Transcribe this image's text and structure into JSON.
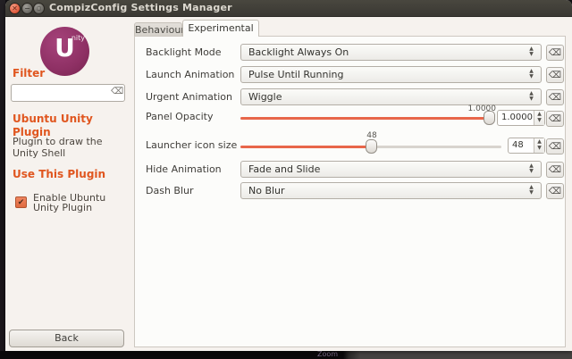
{
  "window": {
    "title": "CompizConfig Settings Manager"
  },
  "icons": {
    "close": "✕",
    "minimize": "−",
    "maximize": "◻",
    "clear": "⌫",
    "check": "✔",
    "spin_up": "▲",
    "spin_down": "▼"
  },
  "sidebar": {
    "logo_main": "U",
    "logo_sub": "nity",
    "filter_label": "Filter",
    "filter_value": "",
    "plugin_title": "Ubuntu Unity Plugin",
    "plugin_description": "Plugin to draw the Unity Shell",
    "use_plugin_heading": "Use This Plugin",
    "enable_label": "Enable Ubuntu Unity Plugin",
    "enable_checked": true,
    "back_label": "Back"
  },
  "tabs": {
    "behaviour": "Behaviour",
    "experimental": "Experimental",
    "active": "Experimental"
  },
  "settings": {
    "rows": [
      {
        "type": "dropdown",
        "label": "Backlight Mode",
        "value": "Backlight Always On"
      },
      {
        "type": "dropdown",
        "label": "Launch Animation",
        "value": "Pulse Until Running"
      },
      {
        "type": "dropdown",
        "label": "Urgent Animation",
        "value": "Wiggle"
      },
      {
        "type": "slider",
        "label": "Panel Opacity",
        "value": "1.0000",
        "slider_percent": 98
      },
      {
        "type": "slider",
        "label": "Launcher icon size",
        "value": "48",
        "slider_percent": 50
      },
      {
        "type": "dropdown",
        "label": "Hide Animation",
        "value": "Fade and Slide"
      },
      {
        "type": "dropdown",
        "label": "Dash Blur",
        "value": "No Blur"
      }
    ]
  },
  "desktop": {
    "background_text": "Zoom"
  },
  "colors": {
    "accent_orange": "#e0561f",
    "slider_fill": "#e8664a",
    "logo_purple": "#8e3064",
    "titlebar": "#3f3d38",
    "close_button": "#dd5436"
  }
}
